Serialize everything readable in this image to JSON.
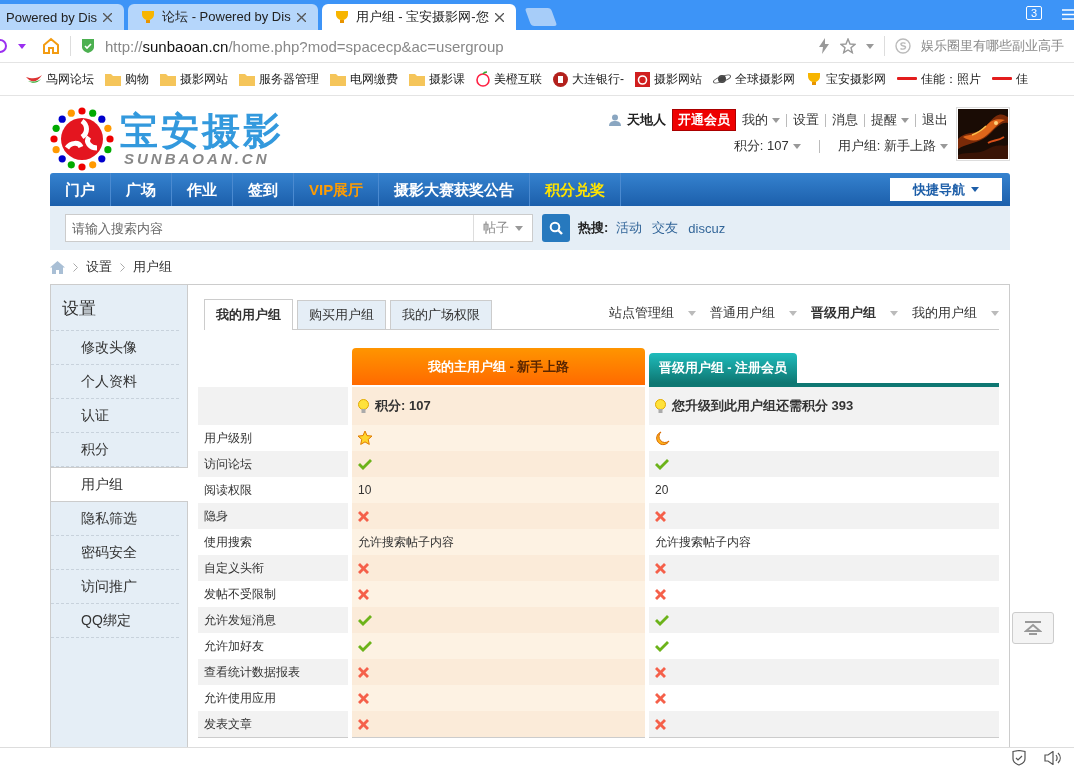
{
  "browser": {
    "tabs": [
      {
        "title": "Powered by Dis",
        "selected": false
      },
      {
        "title": "论坛 - Powered by Dis",
        "selected": false
      },
      {
        "title": "用户组 - 宝安摄影网-您",
        "selected": true
      }
    ],
    "tab_count": "3",
    "url": {
      "scheme": "http://",
      "host": "sunbaoan.cn",
      "path": "/home.php?mod=spacecp&ac=usergroup"
    },
    "search_placeholder": "娱乐圈里有哪些副业高手",
    "bookmarks": [
      "鸟网论坛",
      "购物",
      "摄影网站",
      "服务器管理",
      "电网缴费",
      "摄影课",
      "美橙互联",
      "大连银行-",
      "摄影网站",
      "全球摄影网",
      "宝安摄影网",
      "佳能：照片",
      "佳"
    ]
  },
  "header": {
    "logo_title": "宝安摄影",
    "logo_subtitle": "SUNBAOAN.CN",
    "user": "天地人",
    "vip_button": "开通会员",
    "links": [
      {
        "label": "我的",
        "dropdown": true
      },
      {
        "label": "设置",
        "dropdown": false
      },
      {
        "label": "消息",
        "dropdown": false
      },
      {
        "label": "提醒",
        "dropdown": true
      },
      {
        "label": "退出",
        "dropdown": false
      }
    ],
    "credits": "积分: 107",
    "group": "用户组: 新手上路"
  },
  "nav": {
    "items": [
      {
        "label": "门户",
        "kind": "normal"
      },
      {
        "label": "广场",
        "kind": "normal"
      },
      {
        "label": "作业",
        "kind": "normal"
      },
      {
        "label": "签到",
        "kind": "normal"
      },
      {
        "label": "VIP展厅",
        "kind": "vip"
      },
      {
        "label": "摄影大赛获奖公告",
        "kind": "normal"
      },
      {
        "label": "积分兑奖",
        "kind": "prize"
      }
    ],
    "quick_nav": "快捷导航"
  },
  "search": {
    "placeholder": "请输入搜索内容",
    "scope": "帖子",
    "hot_label": "热搜:",
    "hot": [
      "活动",
      "交友",
      "discuz"
    ]
  },
  "breadcrumb": [
    "设置",
    "用户组"
  ],
  "sidebar": {
    "title": "设置",
    "items": [
      {
        "label": "修改头像",
        "selected": false
      },
      {
        "label": "个人资料",
        "selected": false
      },
      {
        "label": "认证",
        "selected": false
      },
      {
        "label": "积分",
        "selected": false
      },
      {
        "label": "用户组",
        "selected": true
      },
      {
        "label": "隐私筛选",
        "selected": false
      },
      {
        "label": "密码安全",
        "selected": false
      },
      {
        "label": "访问推广",
        "selected": false
      },
      {
        "label": "QQ绑定",
        "selected": false
      }
    ]
  },
  "tabs": [
    {
      "label": "我的用户组",
      "selected": true
    },
    {
      "label": "购买用户组",
      "selected": false
    },
    {
      "label": "我的广场权限",
      "selected": false
    }
  ],
  "group_links": [
    {
      "label": "站点管理组",
      "selected": false
    },
    {
      "label": "普通用户组",
      "selected": false
    },
    {
      "label": "晋级用户组",
      "selected": true
    },
    {
      "label": "我的用户组",
      "selected": false
    }
  ],
  "table": {
    "columns": [
      {
        "kind": "current",
        "title": "我的主用户组",
        "subtitle": "- 新手上路",
        "info": "积分: 107"
      },
      {
        "kind": "upgrade",
        "title": "晋级用户组 - 注册会员",
        "info": "您升级到此用户组还需积分 393"
      }
    ],
    "rows": [
      {
        "label": "用户级别",
        "values": [
          {
            "kind": "star"
          },
          {
            "kind": "moon"
          }
        ]
      },
      {
        "label": "访问论坛",
        "values": [
          {
            "kind": "check"
          },
          {
            "kind": "check"
          }
        ]
      },
      {
        "label": "阅读权限",
        "values": [
          {
            "kind": "text",
            "text": "10"
          },
          {
            "kind": "text",
            "text": "20"
          }
        ]
      },
      {
        "label": "隐身",
        "values": [
          {
            "kind": "cross"
          },
          {
            "kind": "cross"
          }
        ]
      },
      {
        "label": "使用搜索",
        "values": [
          {
            "kind": "text",
            "text": "允许搜索帖子内容"
          },
          {
            "kind": "text",
            "text": "允许搜索帖子内容"
          }
        ]
      },
      {
        "label": "自定义头衔",
        "values": [
          {
            "kind": "cross"
          },
          {
            "kind": "cross"
          }
        ]
      },
      {
        "label": "发帖不受限制",
        "values": [
          {
            "kind": "cross"
          },
          {
            "kind": "cross"
          }
        ]
      },
      {
        "label": "允许发短消息",
        "values": [
          {
            "kind": "check"
          },
          {
            "kind": "check"
          }
        ]
      },
      {
        "label": "允许加好友",
        "values": [
          {
            "kind": "check"
          },
          {
            "kind": "check"
          }
        ]
      },
      {
        "label": "查看统计数据报表",
        "values": [
          {
            "kind": "cross"
          },
          {
            "kind": "cross"
          }
        ]
      },
      {
        "label": "允许使用应用",
        "values": [
          {
            "kind": "cross"
          },
          {
            "kind": "cross"
          }
        ]
      },
      {
        "label": "发表文章",
        "values": [
          {
            "kind": "cross"
          },
          {
            "kind": "cross"
          }
        ]
      }
    ]
  }
}
